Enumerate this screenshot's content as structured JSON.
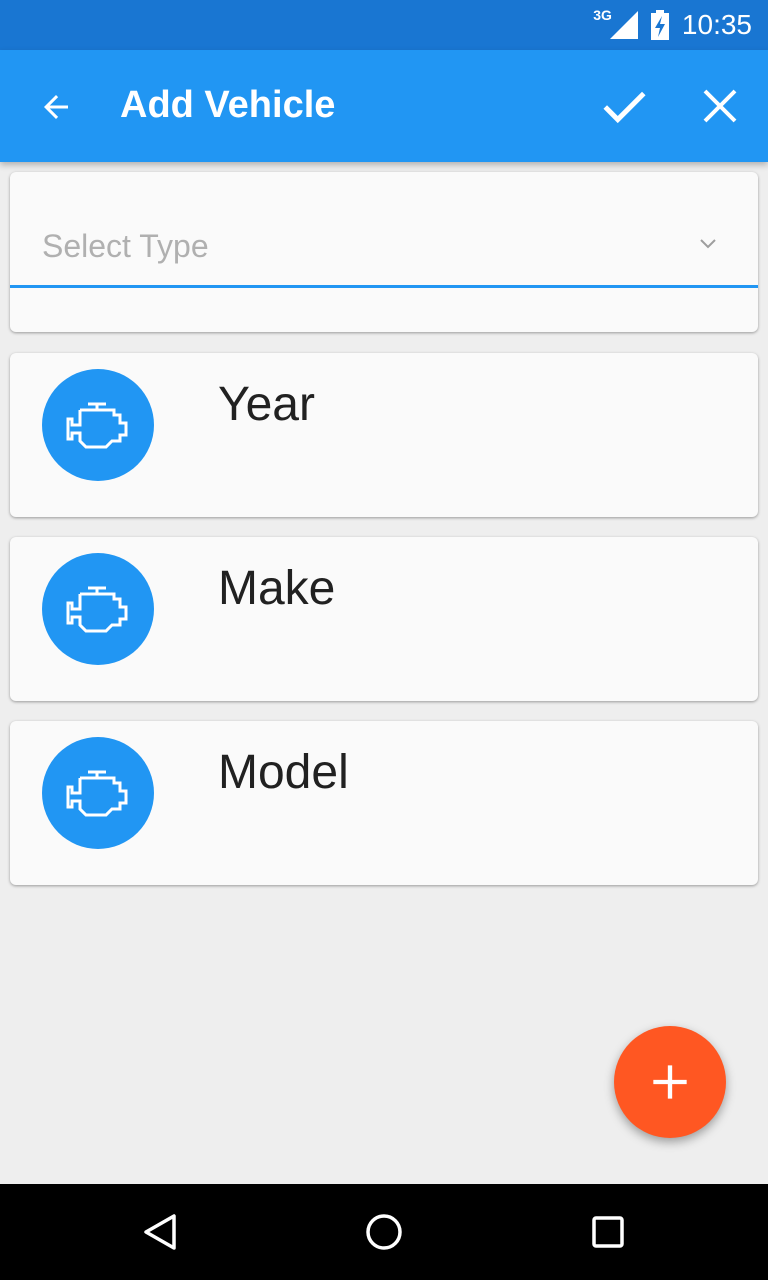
{
  "status_bar": {
    "network_label": "3G",
    "time": "10:35",
    "icons": [
      "signal-icon",
      "battery-charging-icon"
    ]
  },
  "app_bar": {
    "title": "Add Vehicle",
    "back_icon": "arrow-back-icon",
    "actions": [
      {
        "icon": "check-icon"
      },
      {
        "icon": "close-icon"
      }
    ],
    "color": "#2196f3",
    "status_color": "#1976d2"
  },
  "type_select": {
    "placeholder": "Select Type",
    "icon": "chevron-down-icon",
    "underline_color": "#2196f3"
  },
  "items": [
    {
      "label": "Year",
      "icon": "engine-icon"
    },
    {
      "label": "Make",
      "icon": "engine-icon"
    },
    {
      "label": "Model",
      "icon": "engine-icon"
    }
  ],
  "fab": {
    "icon": "plus-icon",
    "color": "#ff5722"
  },
  "nav_bar": {
    "buttons": [
      "back-triangle-icon",
      "home-circle-icon",
      "recent-square-icon"
    ]
  }
}
